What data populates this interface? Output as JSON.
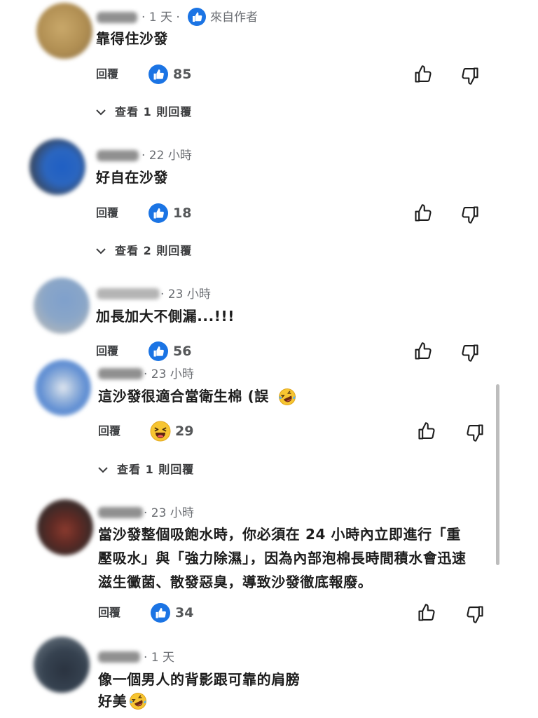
{
  "comments": [
    {
      "time": "· 1 天 ·",
      "author_tag": "來自作者",
      "body_lines": [
        "靠得住沙發"
      ],
      "reply_label": "回覆",
      "reaction": "like-badge-icon",
      "count": "85",
      "replies": "查看 1 則回覆"
    },
    {
      "time": "· 22 小時",
      "body_lines": [
        "好自在沙發"
      ],
      "reply_label": "回覆",
      "reaction": "like-badge-icon",
      "count": "18",
      "replies": "查看 2 則回覆"
    },
    {
      "time": "· 23 小時",
      "body_lines": [
        "加長加大不側漏...!!!"
      ],
      "reply_label": "回覆",
      "reaction": "like-badge-icon",
      "count": "56"
    },
    {
      "time": "· 23 小時",
      "body_lines": [
        "這沙發很適合當衛生棉 (誤"
      ],
      "body_emoji": "rolling-on-floor-laughing-emoji-icon",
      "reply_label": "回覆",
      "reaction": "haha-emoji-icon",
      "count": "29",
      "replies": "查看 1 則回覆"
    },
    {
      "time": "· 23 小時",
      "body_lines": [
        "當沙發整個吸飽水時，你必須在 24 小時內立即進行「重",
        "壓吸水」與「強力除濕」，因為內部泡棉長時間積水會迅速",
        "滋生黴菌、散發惡臭，導致沙發徹底報廢。"
      ],
      "reply_label": "回覆",
      "reaction": "like-badge-icon",
      "count": "34"
    },
    {
      "time": "· 1 天",
      "body_lines": [
        "像一個男人的背影跟可靠的肩膀",
        "好美"
      ],
      "body_emoji": "rolling-on-floor-laughing-emoji-icon"
    }
  ],
  "colors": {
    "like_blue": "#1b74e4",
    "text": "#1d1d1d",
    "meta_gray": "#6b6e73",
    "scrollbar": "#bdbdbd"
  }
}
